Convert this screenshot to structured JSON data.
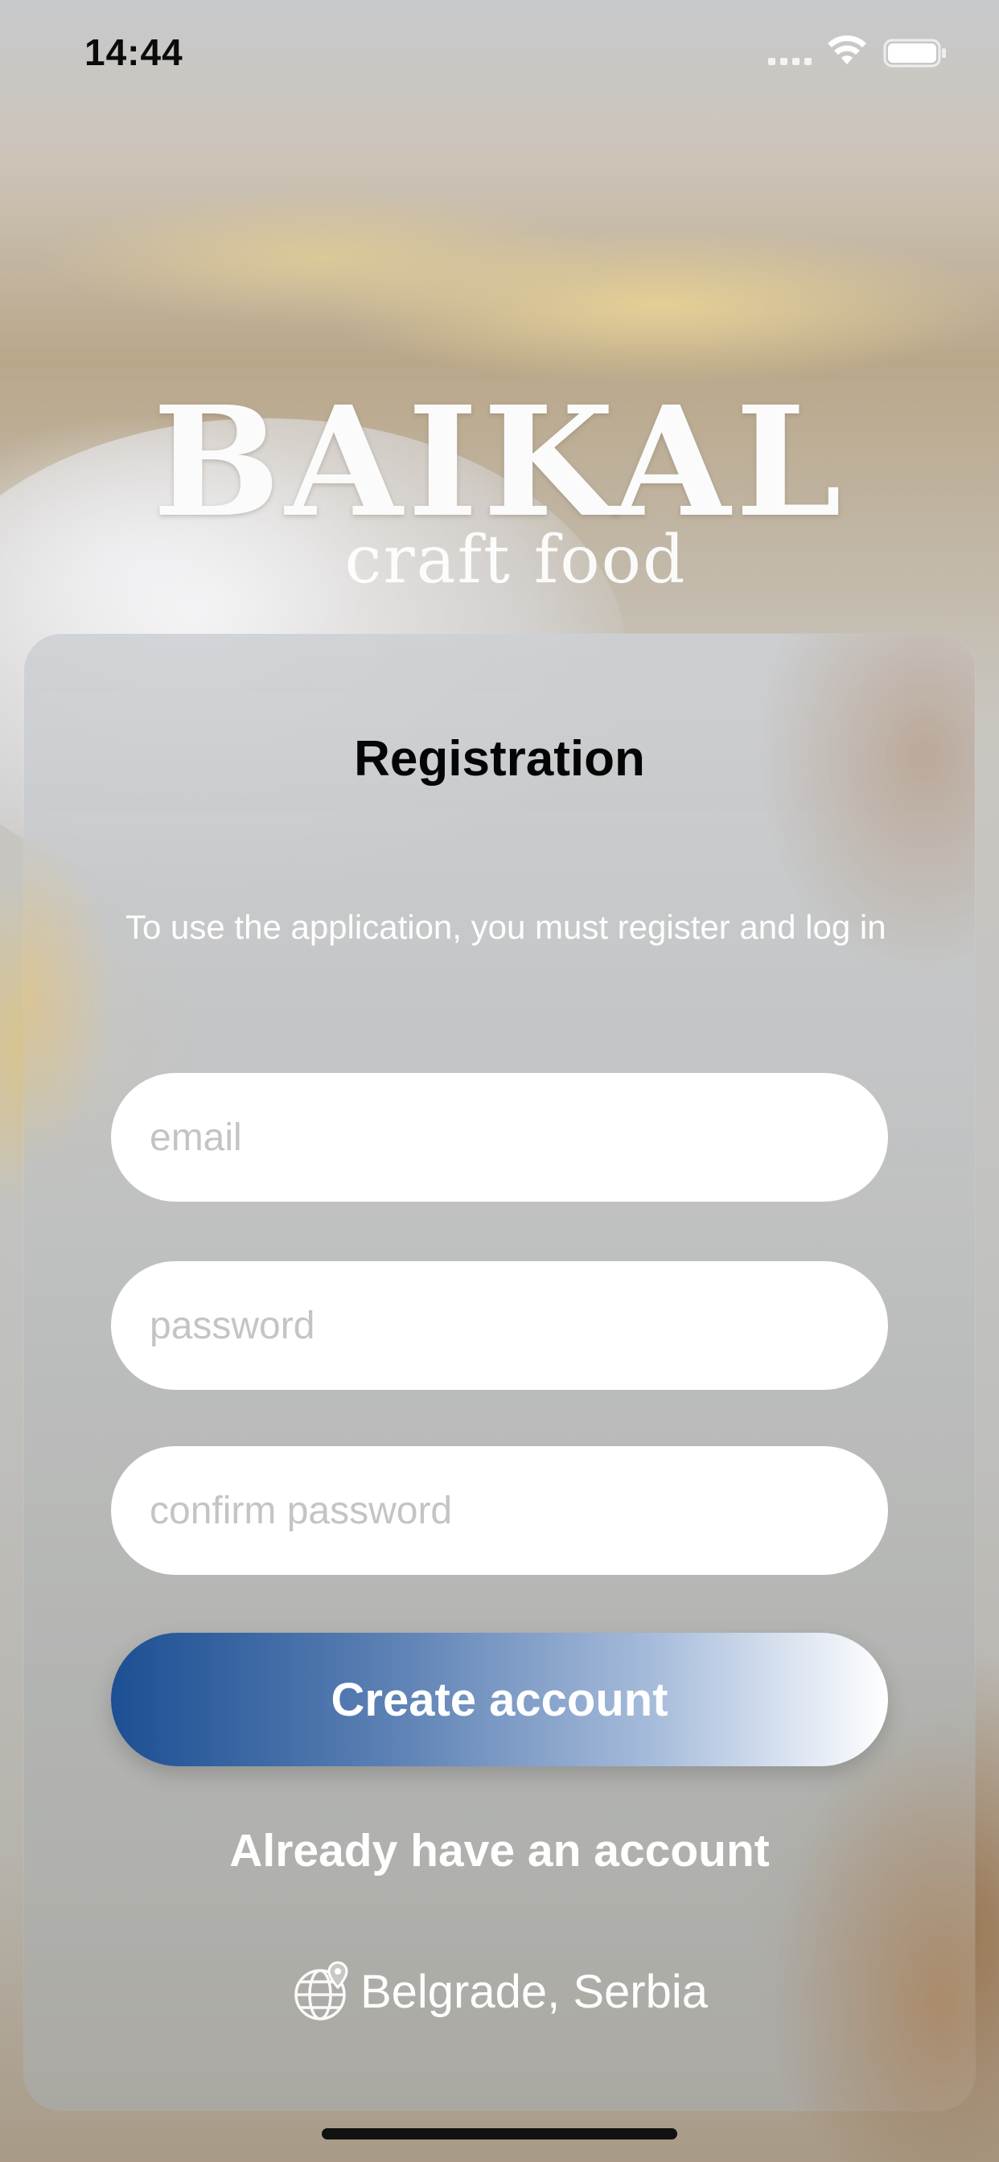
{
  "status_bar": {
    "time": "14:44"
  },
  "logo": {
    "main": "BAIKAL",
    "sub": "craft food"
  },
  "registration": {
    "title": "Registration",
    "description": "To use the application, you must register and log in",
    "email_placeholder": "email",
    "password_placeholder": "password",
    "confirm_password_placeholder": "confirm password",
    "create_account_label": "Create account",
    "login_link_label": "Already have an account"
  },
  "location": {
    "icon": "globe-location-icon",
    "label": "Belgrade, Serbia"
  },
  "colors": {
    "button_gradient_start": "#1c4f93",
    "button_gradient_end": "#ffffff",
    "card_text": "#ffffff",
    "title_text": "#050505"
  }
}
